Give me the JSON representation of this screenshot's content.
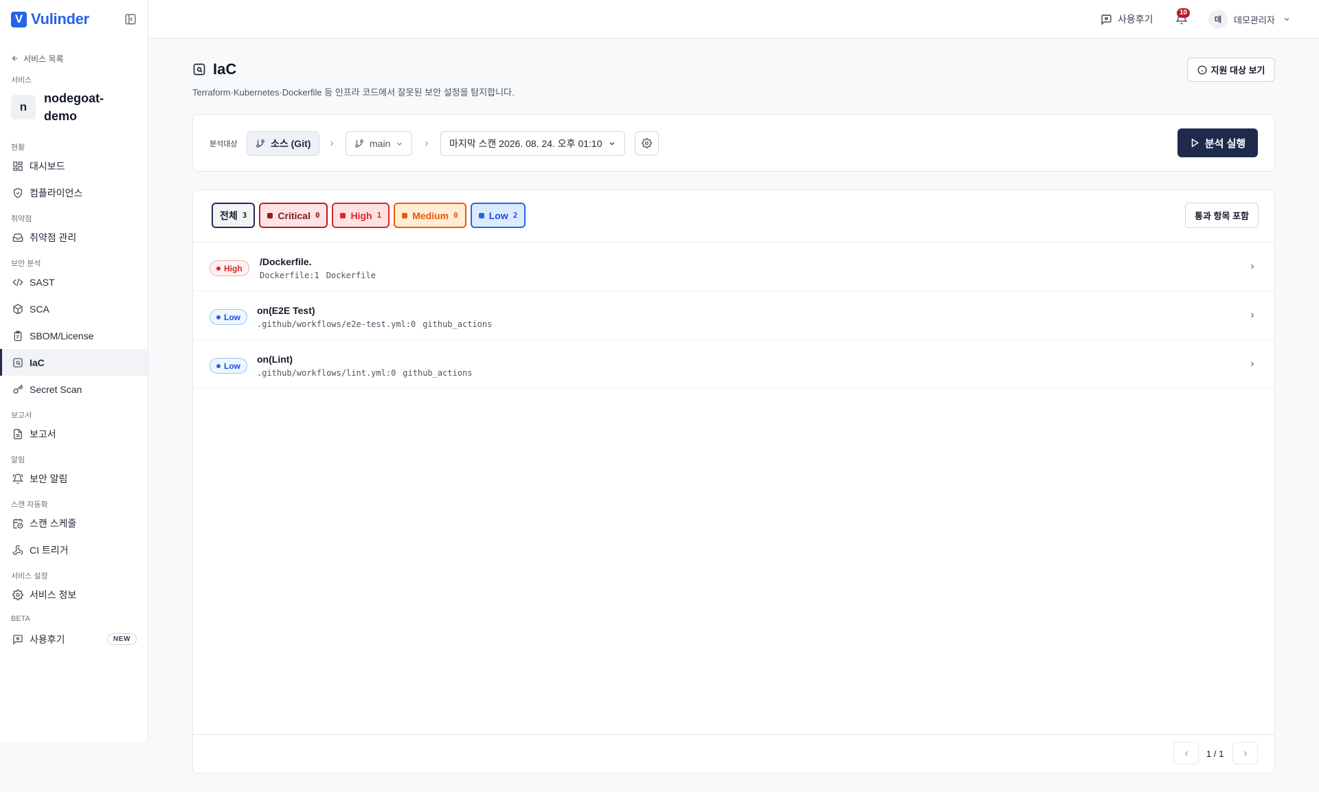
{
  "brand": {
    "name": "Vulinder",
    "mark": "V"
  },
  "sidebar": {
    "back_label": "서비스 목록",
    "service_section": "서비스",
    "service_initial": "n",
    "service_name": "nodegoat-demo",
    "sections": {
      "status": "현황",
      "vuln": "취약점",
      "security": "보안 분석",
      "report": "보고서",
      "alert": "알림",
      "automation": "스캔 자동화",
      "settings": "서비스 설정",
      "beta": "BETA"
    },
    "items": {
      "dashboard": "대시보드",
      "compliance": "컴플라이언스",
      "vuln_mgmt": "취약점 관리",
      "sast": "SAST",
      "sca": "SCA",
      "sbom": "SBOM/License",
      "iac": "IaC",
      "secret": "Secret Scan",
      "report": "보고서",
      "security_alert": "보안 알림",
      "schedule": "스캔 스케줄",
      "ci_trigger": "CI 트리거",
      "service_info": "서비스 정보",
      "review": "사용후기",
      "new_badge": "NEW"
    }
  },
  "header": {
    "review": "사용후기",
    "notif_count": "10",
    "user_initial": "데",
    "user_name": "데모관리자"
  },
  "page": {
    "title": "IaC",
    "description": "Terraform·Kubernetes·Dockerfile 등 인프라 코드에서 잘못된 보안 설정을 탐지합니다.",
    "support_button": "지원 대상 보기"
  },
  "target": {
    "label": "분석대상",
    "source": "소스 (Git)",
    "branch": "main",
    "last_scan": "마지막 스캔 2026. 08. 24. 오후 01:10",
    "run_button": "분석 실행"
  },
  "filters": [
    {
      "label": "전체",
      "count": "3"
    },
    {
      "label": "Critical",
      "count": "0"
    },
    {
      "label": "High",
      "count": "1"
    },
    {
      "label": "Medium",
      "count": "0"
    },
    {
      "label": "Low",
      "count": "2"
    }
  ],
  "include_passed": "통과 항목 포함",
  "findings": [
    {
      "severity": "High",
      "title": "/Dockerfile.",
      "location": "Dockerfile:1",
      "type": "Dockerfile"
    },
    {
      "severity": "Low",
      "title": "on(E2E Test)",
      "location": ".github/workflows/e2e-test.yml:0",
      "type": "github_actions"
    },
    {
      "severity": "Low",
      "title": "on(Lint)",
      "location": ".github/workflows/lint.yml:0",
      "type": "github_actions"
    }
  ],
  "pagination": {
    "text": "1 / 1"
  },
  "colors": {
    "brand": "#2563eb",
    "primary_dark": "#1e2b4d",
    "critical": "#991b1b",
    "high": "#dc2626",
    "medium": "#ea580c",
    "low": "#2563eb"
  }
}
